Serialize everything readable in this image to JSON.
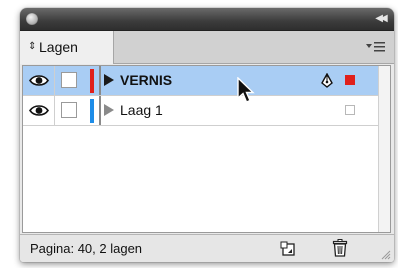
{
  "panel": {
    "tab_label": "Lagen"
  },
  "layers": [
    {
      "name": "VERNIS",
      "selected": true,
      "color": "#e0201b"
    },
    {
      "name": "Laag 1",
      "selected": false,
      "color": "#1e8de8"
    }
  ],
  "status": {
    "text": "Pagina: 40, 2 lagen"
  },
  "colors": {
    "selection": "#a9cdf4",
    "vernis_layer": "#e0201b",
    "laag1_layer": "#1e8de8"
  },
  "icons": {
    "visibility": "eye-icon",
    "lock": "lock-toggle",
    "expand": "triangle-right-icon",
    "draw": "pen-icon",
    "new_layer": "new-layer-icon",
    "delete": "trash-icon",
    "menu": "panel-menu-icon"
  }
}
